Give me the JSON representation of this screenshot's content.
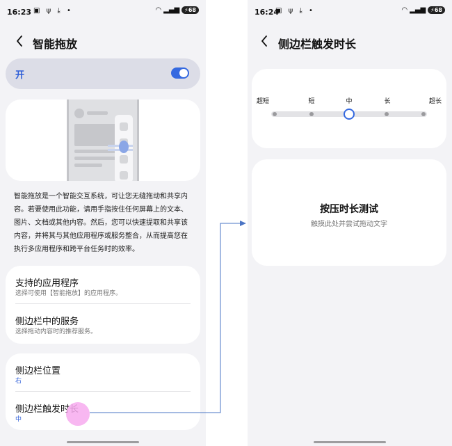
{
  "left": {
    "status": {
      "time": "16:23",
      "battery": "68"
    },
    "header": {
      "title": "智能拖放"
    },
    "toggle": {
      "label": "开",
      "on": true
    },
    "description": "智能拖放是一个智能交互系统，可让您无缝拖动和共享内容。若要使用此功能，请用手指按住任何屏幕上的文本、图片、文档或其他内容。然后，您可以快速提取和共享该内容，并将其与其他应用程序或服务整合，从而提高您在执行多应用程序和跨平台任务时的效率。",
    "group1": [
      {
        "title": "支持的应用程序",
        "subtitle": "选择可使用【智能拖放】的应用程序。"
      },
      {
        "title": "侧边栏中的服务",
        "subtitle": "选择拖动内容时的推荐服务。"
      }
    ],
    "group2": [
      {
        "title": "侧边栏位置",
        "value": "右"
      },
      {
        "title": "侧边栏触发时长",
        "value": "中"
      }
    ]
  },
  "right": {
    "status": {
      "time": "16:24",
      "battery": "68"
    },
    "header": {
      "title": "侧边栏触发时长"
    },
    "slider": {
      "options": [
        "超短",
        "短",
        "中",
        "长",
        "超长"
      ],
      "selected": "中"
    },
    "test_area": {
      "title": "按压时长测试",
      "subtitle": "触摸此处并尝试拖动文字"
    }
  },
  "colors": {
    "accent": "#3569e0",
    "toggle_bg": "#dcdde7",
    "touch_indicator": "#f7aaef"
  }
}
